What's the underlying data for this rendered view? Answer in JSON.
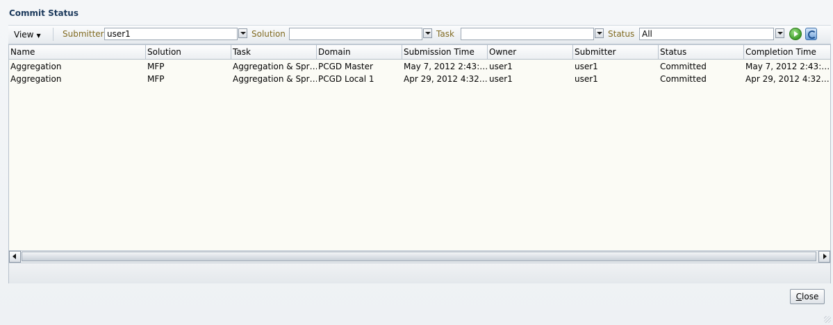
{
  "dialog": {
    "title": "Commit Status",
    "close_label": "Close"
  },
  "toolbar": {
    "view_label": "View",
    "filters": [
      {
        "label": "Submitter",
        "value": "user1"
      },
      {
        "label": "Solution",
        "value": ""
      },
      {
        "label": "Task",
        "value": ""
      },
      {
        "label": "Status",
        "value": "All"
      }
    ],
    "icons": [
      "chevron-down-icon",
      "go-icon",
      "refresh-icon"
    ]
  },
  "table": {
    "columns": [
      "Name",
      "Solution",
      "Task",
      "Domain",
      "Submission Time",
      "Owner",
      "Submitter",
      "Status",
      "Completion Time"
    ],
    "rows": [
      [
        "Aggregation",
        "MFP",
        "Aggregation & Spr…",
        "PCGD Master",
        "May 7, 2012 2:43:…",
        "user1",
        "user1",
        "Committed",
        "May 7, 2012 2:43:…"
      ],
      [
        "Aggregation",
        "MFP",
        "Aggregation & Spr…",
        "PCGD Local 1",
        "Apr 29, 2012 4:32…",
        "user1",
        "user1",
        "Committed",
        "Apr 29, 2012 4:32…"
      ]
    ]
  },
  "colors": {
    "title": "#1c3a5c",
    "filter_label": "#806a20",
    "table_bg": "#fbfbf5"
  }
}
